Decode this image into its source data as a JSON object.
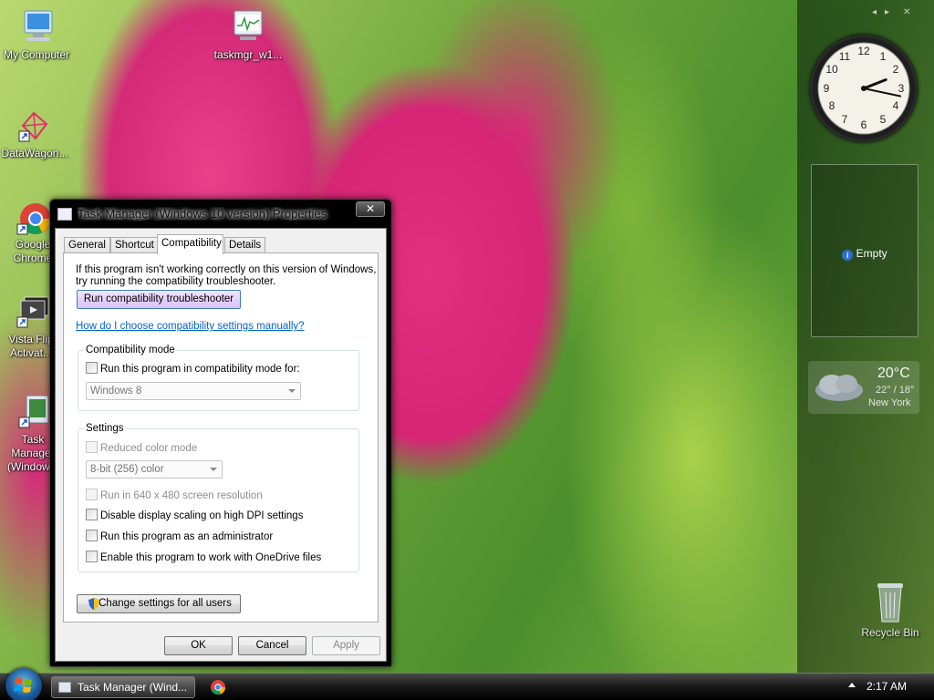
{
  "desktop": {
    "icons": [
      {
        "label": "My Computer"
      },
      {
        "label": "taskmgr_w1..."
      },
      {
        "label": "DataWagon..."
      },
      {
        "label": "Google Chrome"
      },
      {
        "label": "Vista Flip Activat..."
      },
      {
        "label": "Task Manager (Window..."
      }
    ],
    "recycle_bin": "Recycle Bin"
  },
  "sidebar": {
    "controls": [
      "◂",
      "▸",
      "✕"
    ],
    "slideshow_label": "Empty",
    "weather": {
      "temp": "20°C",
      "range": "22° / 18°",
      "city": "New York"
    },
    "clock": {
      "hour": 2,
      "minute": 17
    }
  },
  "dialog": {
    "title": "Task Manager (Windows 10 version) Properties",
    "close": "✕",
    "tabs": [
      "General",
      "Shortcut",
      "Compatibility",
      "Details"
    ],
    "active_tab": "Compatibility",
    "intro": "If this program isn't working correctly on this version of Windows, try running the compatibility troubleshooter.",
    "troubleshooter_button": "Run compatibility troubleshooter",
    "help_link": "How do I choose compatibility settings manually?",
    "compat_mode": {
      "label": "Compatibility mode",
      "checkbox": "Run this program in compatibility mode for:",
      "select_value": "Windows 8"
    },
    "settings": {
      "label": "Settings",
      "reduced_color": "Reduced color mode",
      "color_select": "8-bit (256) color",
      "res_640": "Run in 640 x 480 screen resolution",
      "dpi": "Disable display scaling on high DPI settings",
      "admin": "Run this program as an administrator",
      "onedrive": "Enable this program to work with OneDrive files"
    },
    "change_all_users": "Change settings for all users",
    "ok": "OK",
    "cancel": "Cancel",
    "apply": "Apply"
  },
  "taskbar": {
    "task_button": "Task Manager (Wind...",
    "time": "2:17 AM"
  }
}
